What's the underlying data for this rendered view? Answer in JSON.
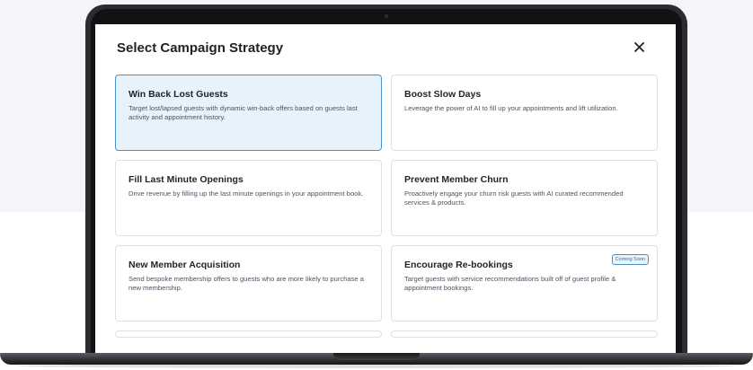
{
  "modal": {
    "title": "Select Campaign Strategy",
    "close_icon": "close-icon"
  },
  "cards": [
    {
      "title": "Win Back Lost Guests",
      "description": "Target lost/lapsed guests with dynamic win-back offers based on guests last activity and appointment history.",
      "selected": true,
      "badge": ""
    },
    {
      "title": "Boost Slow Days",
      "description": "Leverage the power of AI to fill up your appointments and lift utilization.",
      "selected": false,
      "badge": ""
    },
    {
      "title": "Fill Last Minute Openings",
      "description": "Drive revenue by filling up the last minute openings in your appointment book.",
      "selected": false,
      "badge": ""
    },
    {
      "title": "Prevent Member Churn",
      "description": "Proactively engage your churn risk guests with AI curated recommended services & products.",
      "selected": false,
      "badge": ""
    },
    {
      "title": "New Member Acquisition",
      "description": "Send bespoke membership offers to guests who are more likely to purchase a new membership.",
      "selected": false,
      "badge": ""
    },
    {
      "title": "Encourage Re-bookings",
      "description": "Target guests with service recommendations built off of guest profile & appointment bookings.",
      "selected": false,
      "badge": "Coming Soon"
    }
  ],
  "colors": {
    "selected_background": "#e7f2fb",
    "selected_border": "#4a90c9",
    "laptop_frame": "#2b2c30"
  }
}
